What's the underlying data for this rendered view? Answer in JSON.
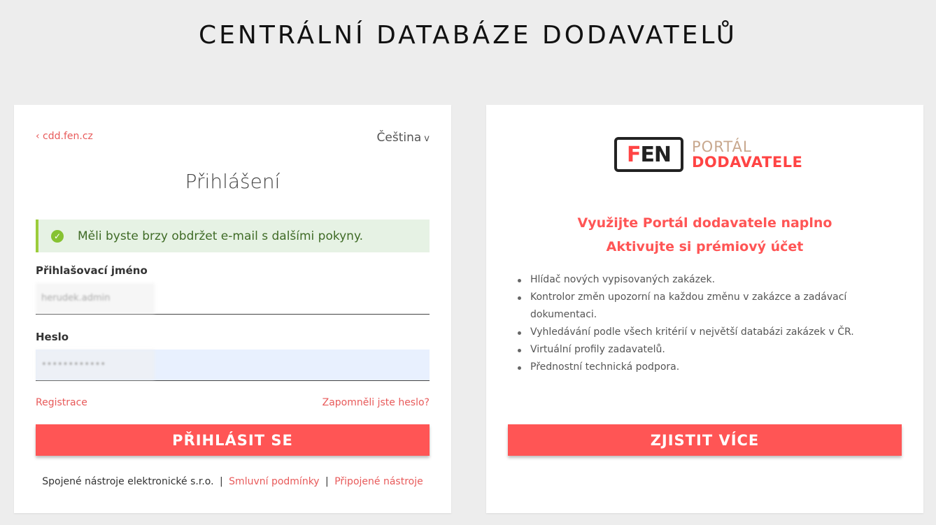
{
  "page": {
    "title": "CENTRÁLNÍ DATABÁZE DODAVATELŮ"
  },
  "login": {
    "back_link": "‹ cdd.fen.cz",
    "language": "Čeština",
    "language_chevron": "v",
    "title": "Přihlášení",
    "alert_message": "Měli byste brzy obdržet e-mail s dalšími pokyny.",
    "username_label": "Přihlašovací jméno",
    "username_value": "herudek.admin",
    "password_label": "Heslo",
    "password_value": "••••••••••••",
    "register_link": "Registrace",
    "forgot_link": "Zapomněli jste heslo?",
    "submit_label": "PŘIHLÁSIT SE",
    "footer": {
      "company": "Spojené nástroje elektronické s.r.o.",
      "separator": "|",
      "terms": "Smluvní podmínky",
      "tools": "Připojené nástroje"
    }
  },
  "promo": {
    "logo": {
      "mark_f": "F",
      "mark_en": "EN",
      "line1": "PORTÁL",
      "line2": "DODAVATELE"
    },
    "headline1": "Využijte Portál dodavatele naplno",
    "headline2": "Aktivujte si prémiový účet",
    "features": [
      "Hlídač nových vypisovaných zakázek.",
      "Kontrolor změn upozorní na každou změnu v zakázce a zadávací dokumentaci.",
      "Vyhledávání podle všech kritérií v největší databázi zakázek v ČR.",
      "Virtuální profily zadavatelů.",
      "Přednostní technická podpora."
    ],
    "button_label": "ZJISTIT VÍCE"
  },
  "colors": {
    "accent": "#ff5555",
    "link": "#e85a5a",
    "success_bg": "#e6f2e4",
    "success_border": "#9ccc3b"
  }
}
